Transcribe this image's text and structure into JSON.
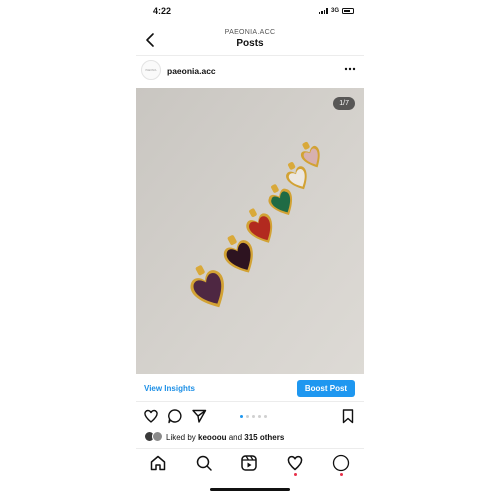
{
  "status_bar": {
    "time": "4:22",
    "network": "3G"
  },
  "header": {
    "subtitle": "PAEONIA.ACC",
    "title": "Posts"
  },
  "post": {
    "username": "paeonia.acc",
    "avatar_text": "PAEONIA",
    "image_counter": "1/7",
    "carousel": {
      "total": 5,
      "active": 1
    }
  },
  "insights": {
    "view_label": "View Insights",
    "boost_label": "Boost Post"
  },
  "likes": {
    "prefix": "Liked by ",
    "user": "keooou",
    "middle": " and ",
    "others": "315 others"
  },
  "colors": {
    "accent": "#1e97f0",
    "link": "#1c8fe6",
    "photo_bg": "#d2cfca"
  },
  "icons": {
    "actions": [
      "heart-icon",
      "comment-icon",
      "share-icon",
      "bookmark-icon"
    ],
    "tabs": [
      "home-icon",
      "search-icon",
      "reels-icon",
      "activity-heart-icon",
      "profile-icon"
    ]
  }
}
